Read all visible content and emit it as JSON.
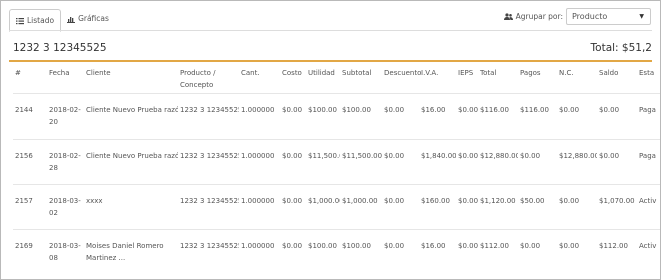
{
  "tabs": [
    {
      "label": "Listado",
      "icon": "list-icon",
      "active": true
    },
    {
      "label": "Gráficas",
      "icon": "bar-chart-icon",
      "active": false
    }
  ],
  "group_by": {
    "label": "Agrupar por:",
    "icon": "users-icon",
    "selected": "Producto"
  },
  "section": {
    "title": "1232 3 12345525",
    "total": "Total: $51,2"
  },
  "table": {
    "headers": [
      "#",
      "Fecha",
      "Cliente",
      "Producto / Concepto",
      "Cant.",
      "Costo",
      "Utilidad",
      "Subtotal",
      "Descuento",
      "I.V.A.",
      "IEPS",
      "Total",
      "Pagos",
      "N.C.",
      "Saldo",
      "Esta"
    ],
    "rows": [
      [
        "2144",
        "2018-02-20",
        "Cliente Nuevo Prueba razón",
        "1232 3 12345525",
        "1.000000",
        "$0.00",
        "$100.00",
        "$100.00",
        "$0.00",
        "$16.00",
        "$0.00",
        "$116.00",
        "$116.00",
        "$0.00",
        "$0.00",
        "Paga"
      ],
      [
        "2156",
        "2018-02-28",
        "Cliente Nuevo Prueba razón",
        "1232 3 12345525",
        "1.000000",
        "$0.00",
        "$11,500.00",
        "$11,500.00",
        "$0.00",
        "$1,840.00",
        "$0.00",
        "$12,880.00",
        "$0.00",
        "$12,880.00",
        "$0.00",
        "Paga"
      ],
      [
        "2157",
        "2018-03-02",
        "xxxx",
        "1232 3 12345525",
        "1.000000",
        "$0.00",
        "$1,000.00",
        "$1,000.00",
        "$0.00",
        "$160.00",
        "$0.00",
        "$1,120.00",
        "$50.00",
        "$0.00",
        "$1,070.00",
        "Activ"
      ],
      [
        "2169",
        "2018-03-08",
        "Moises Daniel Romero Martinez ...",
        "1232 3 12345525",
        "1.000000",
        "$0.00",
        "$100.00",
        "$100.00",
        "$0.00",
        "$16.00",
        "$0.00",
        "$112.00",
        "$0.00",
        "$0.00",
        "$112.00",
        "Activ"
      ]
    ]
  }
}
